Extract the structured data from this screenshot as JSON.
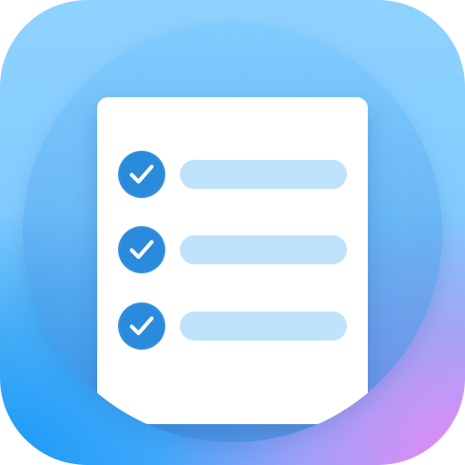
{
  "app_icon": {
    "name": "checklist-app-icon",
    "colors": {
      "top_left": "#8fd2ff",
      "left_bottom": "#1698f6",
      "right_bottom": "#ee86f2",
      "document": "#ffffff",
      "check_fill": "#2a8bdc",
      "line_fill": "#bfe3fb"
    },
    "items": [
      {
        "checked": true
      },
      {
        "checked": true
      },
      {
        "checked": true
      }
    ]
  }
}
